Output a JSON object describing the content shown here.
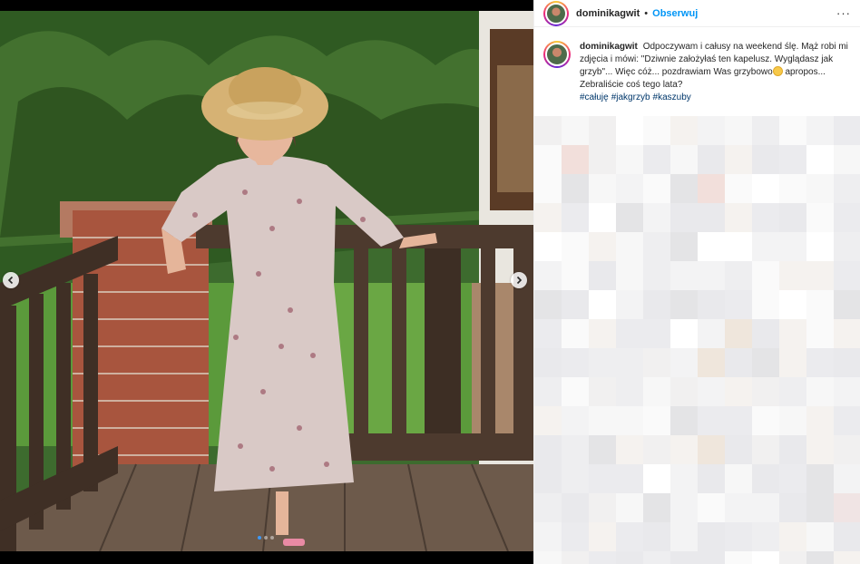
{
  "post": {
    "username": "dominikagwit",
    "separator": "•",
    "follow_label": "Obserwuj",
    "more_icon": "more-horizontal-icon",
    "more_glyph": "···"
  },
  "caption": {
    "username": "dominikagwit",
    "text_before_emoji": "Odpoczywam i całusy na weekend ślę. Mąż robi mi zdjęcia i mówi: \"Dziwnie założyłaś ten kapelusz. Wyglądasz jak grzyb\"... Więc cóż... pozdrawiam Was grzybowo",
    "text_after_emoji": " apropos... Zebraliście coś tego lata?",
    "hashtags": [
      "#całuję",
      "#jakgrzyb",
      "#kaszuby"
    ]
  },
  "carousel": {
    "prev_icon": "chevron-left-icon",
    "next_icon": "chevron-right-icon",
    "slide_count": 3,
    "active_slide": 1
  },
  "colors": {
    "accent": "#0095f6",
    "hashtag": "#00376b",
    "carousel_active_dot": "#3e98f5"
  }
}
